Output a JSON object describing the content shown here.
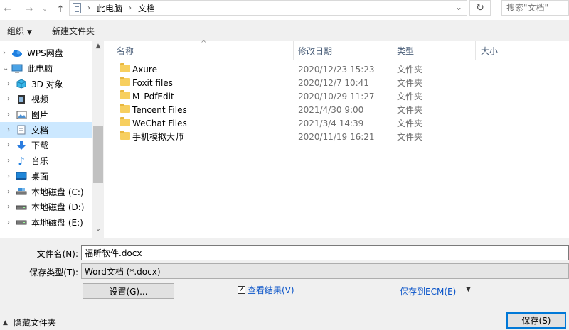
{
  "address": {
    "breadcrumb": [
      "此电脑",
      "文档"
    ],
    "search_placeholder": "搜索\"文档\""
  },
  "toolbar": {
    "organize_label": "组织",
    "new_folder_label": "新建文件夹"
  },
  "nav": {
    "items": [
      {
        "label": "WPS网盘",
        "icon": "cloud-icon"
      },
      {
        "label": "此电脑",
        "icon": "computer-icon"
      },
      {
        "label": "3D 对象",
        "icon": "cube-icon"
      },
      {
        "label": "视频",
        "icon": "video-icon"
      },
      {
        "label": "图片",
        "icon": "picture-icon"
      },
      {
        "label": "文档",
        "icon": "document-icon"
      },
      {
        "label": "下载",
        "icon": "download-icon"
      },
      {
        "label": "音乐",
        "icon": "music-icon"
      },
      {
        "label": "桌面",
        "icon": "desktop-icon"
      },
      {
        "label": "本地磁盘 (C:)",
        "icon": "drive-icon"
      },
      {
        "label": "本地磁盘 (D:)",
        "icon": "drive-icon"
      },
      {
        "label": "本地磁盘 (E:)",
        "icon": "drive-icon"
      }
    ]
  },
  "columns": {
    "name": "名称",
    "date": "修改日期",
    "type": "类型",
    "size": "大小"
  },
  "files": [
    {
      "name": "Axure",
      "date": "2020/12/23 15:23",
      "type": "文件夹"
    },
    {
      "name": "Foxit files",
      "date": "2020/12/7 10:41",
      "type": "文件夹"
    },
    {
      "name": "M_PdfEdit",
      "date": "2020/10/29 11:27",
      "type": "文件夹"
    },
    {
      "name": "Tencent Files",
      "date": "2021/4/30 9:00",
      "type": "文件夹"
    },
    {
      "name": "WeChat Files",
      "date": "2021/3/4 14:39",
      "type": "文件夹"
    },
    {
      "name": "手机模拟大师",
      "date": "2020/11/19 16:21",
      "type": "文件夹"
    }
  ],
  "form": {
    "filename_label": "文件名(N):",
    "filename_value": "福昕软件.docx",
    "filetype_label": "保存类型(T):",
    "filetype_value": "Word文档 (*.docx)",
    "settings_label": "设置(G)...",
    "view_results_label": "查看结果(V)",
    "save_to_ecm_label": "保存到ECM(E)",
    "hide_folders_label": "隐藏文件夹",
    "save_label": "保存(S)"
  }
}
